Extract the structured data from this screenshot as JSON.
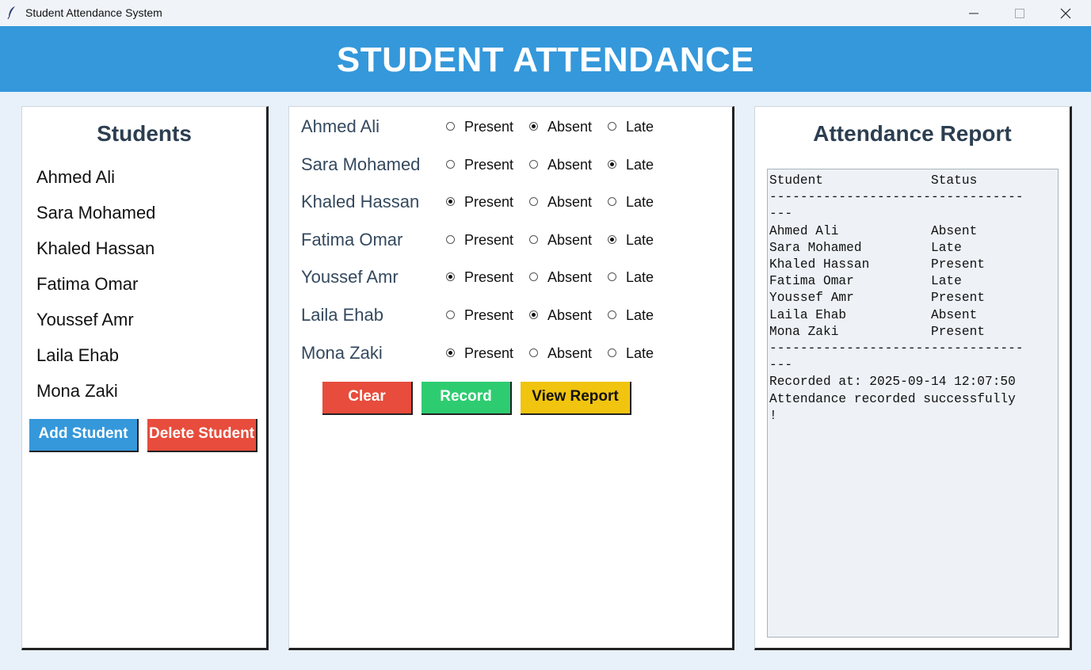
{
  "window": {
    "title": "Student Attendance System"
  },
  "header": {
    "title": "STUDENT ATTENDANCE"
  },
  "students_panel": {
    "title": "Students",
    "items": [
      "Ahmed Ali",
      "Sara Mohamed",
      "Khaled Hassan",
      "Fatima Omar",
      "Youssef Amr",
      "Laila Ehab",
      "Mona Zaki"
    ],
    "add_label": "Add Student",
    "delete_label": "Delete Student"
  },
  "attendance_panel": {
    "options": [
      "Present",
      "Absent",
      "Late"
    ],
    "rows": [
      {
        "name": "Ahmed Ali",
        "status": "Absent"
      },
      {
        "name": "Sara Mohamed",
        "status": "Late"
      },
      {
        "name": "Khaled Hassan",
        "status": "Present"
      },
      {
        "name": "Fatima Omar",
        "status": "Late"
      },
      {
        "name": "Youssef Amr",
        "status": "Present"
      },
      {
        "name": "Laila Ehab",
        "status": "Absent"
      },
      {
        "name": "Mona Zaki",
        "status": "Present"
      }
    ],
    "clear_label": "Clear",
    "record_label": "Record",
    "view_label": "View Report"
  },
  "report_panel": {
    "title": "Attendance Report",
    "lines": [
      "Student              Status",
      "---------------------------------",
      "---",
      "Ahmed Ali            Absent",
      "Sara Mohamed         Late",
      "Khaled Hassan        Present",
      "Fatima Omar          Late",
      "Youssef Amr          Present",
      "Laila Ehab           Absent",
      "Mona Zaki            Present",
      "---------------------------------",
      "---",
      "Recorded at: 2025-09-14 12:07:50",
      "Attendance recorded successfully",
      "!"
    ]
  },
  "colors": {
    "header": "#3498db",
    "add_button": "#3498db",
    "delete_button": "#e74c3c",
    "clear_button": "#e74c3c",
    "record_button": "#2ecc71",
    "view_button": "#f1c40f"
  },
  "icons": {
    "app": "feather-icon",
    "minimize": "minimize-icon",
    "maximize": "maximize-icon",
    "close": "close-icon"
  }
}
